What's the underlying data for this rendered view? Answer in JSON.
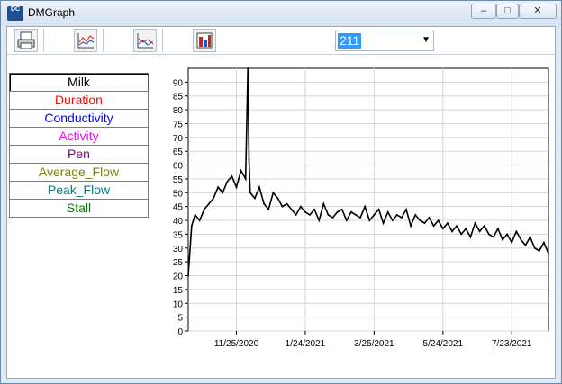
{
  "window": {
    "title": "DMGraph",
    "icon_label": "DC",
    "minimize": "–",
    "maximize": "□",
    "close": "✕"
  },
  "toolbar": {
    "buttons": [
      {
        "name": "print-icon"
      },
      {
        "name": "line-graph-icon"
      },
      {
        "name": "area-graph-icon"
      },
      {
        "name": "bar-graph-icon"
      }
    ],
    "cow_select": {
      "value": "211",
      "arrow": "▼"
    }
  },
  "legend": {
    "items": [
      {
        "label": "Milk",
        "color": "#000000"
      },
      {
        "label": "Duration",
        "color": "#ff0000"
      },
      {
        "label": "Conductivity",
        "color": "#0000ff"
      },
      {
        "label": "Activity",
        "color": "#ff00ff"
      },
      {
        "label": "Pen",
        "color": "#800080"
      },
      {
        "label": "Average_Flow",
        "color": "#808000"
      },
      {
        "label": "Peak_Flow",
        "color": "#008080"
      },
      {
        "label": "Stall",
        "color": "#008000"
      }
    ]
  },
  "chart_data": {
    "type": "line",
    "title": "",
    "xlabel": "",
    "ylabel": "",
    "ylim": [
      0,
      95
    ],
    "y_ticks": [
      "0",
      "5",
      "10",
      "15",
      "20",
      "25",
      "30",
      "35",
      "40",
      "45",
      "50",
      "55",
      "60",
      "65",
      "70",
      "75",
      "80",
      "85",
      "90"
    ],
    "x_ticks": [
      "11/25/2020",
      "1/24/2021",
      "3/25/2021",
      "5/24/2021",
      "7/23/2021"
    ],
    "xlim": [
      "10/14/2020",
      "8/24/2021"
    ],
    "grid": true,
    "series": [
      {
        "color": "#000000",
        "x": [
          "10/14/2020",
          "10/17/2020",
          "10/20/2020",
          "10/24/2020",
          "10/28/2020",
          "11/1/2020",
          "11/5/2020",
          "11/9/2020",
          "11/13/2020",
          "11/17/2020",
          "11/21/2020",
          "11/25/2020",
          "11/29/2020",
          "12/3/2020",
          "12/5/2020",
          "12/6/2020",
          "12/7/2020",
          "12/11/2020",
          "12/15/2020",
          "12/19/2020",
          "12/23/2020",
          "12/27/2020",
          "12/31/2020",
          "1/4/2021",
          "1/8/2021",
          "1/12/2021",
          "1/16/2021",
          "1/20/2021",
          "1/24/2021",
          "1/28/2021",
          "2/1/2021",
          "2/5/2021",
          "2/9/2021",
          "2/13/2021",
          "2/17/2021",
          "2/21/2021",
          "2/25/2021",
          "3/1/2021",
          "3/5/2021",
          "3/9/2021",
          "3/13/2021",
          "3/17/2021",
          "3/21/2021",
          "3/25/2021",
          "3/29/2021",
          "4/2/2021",
          "4/6/2021",
          "4/10/2021",
          "4/14/2021",
          "4/18/2021",
          "4/22/2021",
          "4/26/2021",
          "4/30/2021",
          "5/4/2021",
          "5/8/2021",
          "5/12/2021",
          "5/16/2021",
          "5/20/2021",
          "5/24/2021",
          "5/28/2021",
          "6/1/2021",
          "6/5/2021",
          "6/9/2021",
          "6/13/2021",
          "6/17/2021",
          "6/21/2021",
          "6/25/2021",
          "6/29/2021",
          "7/3/2021",
          "7/7/2021",
          "7/11/2021",
          "7/15/2021",
          "7/19/2021",
          "7/23/2021",
          "7/27/2021",
          "7/31/2021",
          "8/4/2021",
          "8/8/2021",
          "8/12/2021",
          "8/16/2021",
          "8/20/2021",
          "8/24/2021"
        ],
        "values": [
          20,
          38,
          42,
          40,
          44,
          46,
          48,
          52,
          50,
          54,
          56,
          52,
          58,
          55,
          96,
          62,
          50,
          48,
          52,
          46,
          44,
          50,
          48,
          45,
          46,
          44,
          42,
          45,
          43,
          42,
          44,
          40,
          46,
          42,
          41,
          43,
          44,
          40,
          43,
          42,
          41,
          45,
          40,
          42,
          44,
          39,
          43,
          40,
          42,
          41,
          44,
          38,
          42,
          40,
          39,
          41,
          38,
          40,
          37,
          39,
          36,
          38,
          35,
          37,
          34,
          39,
          36,
          38,
          35,
          34,
          37,
          33,
          35,
          32,
          36,
          33,
          31,
          34,
          30,
          29,
          32,
          28
        ]
      }
    ]
  }
}
